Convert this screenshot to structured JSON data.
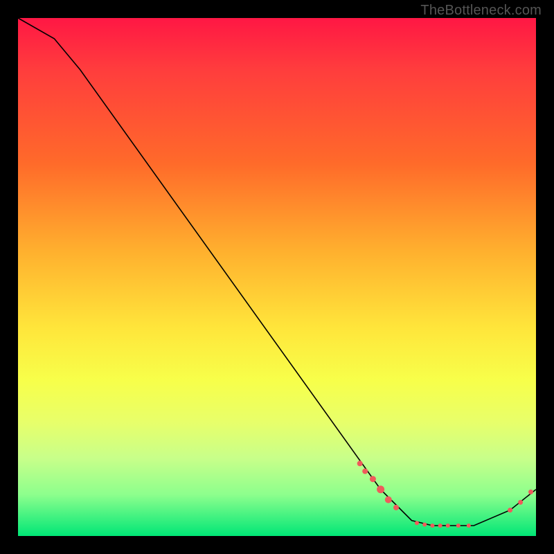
{
  "watermark": "TheBottleneck.com",
  "colors": {
    "gradient_top": "#ff1744",
    "gradient_mid": "#ffe63b",
    "gradient_bottom": "#00e676",
    "curve": "#000000",
    "marker": "#ef5b5b",
    "background": "#000000"
  },
  "chart_data": {
    "type": "line",
    "title": "",
    "xlabel": "",
    "ylabel": "",
    "xlim": [
      0,
      100
    ],
    "ylim": [
      0,
      100
    ],
    "curve": [
      {
        "x": 0,
        "y": 100
      },
      {
        "x": 7,
        "y": 96
      },
      {
        "x": 12,
        "y": 90
      },
      {
        "x": 70,
        "y": 9
      },
      {
        "x": 76,
        "y": 3
      },
      {
        "x": 80,
        "y": 2
      },
      {
        "x": 88,
        "y": 2
      },
      {
        "x": 95,
        "y": 5
      },
      {
        "x": 100,
        "y": 9
      }
    ],
    "marker_clusters": [
      {
        "x": 66,
        "y": 14,
        "r": 4
      },
      {
        "x": 67,
        "y": 12.5,
        "r": 4
      },
      {
        "x": 68.5,
        "y": 11,
        "r": 4.5
      },
      {
        "x": 70,
        "y": 9,
        "r": 5.5
      },
      {
        "x": 71.5,
        "y": 7,
        "r": 5
      },
      {
        "x": 73,
        "y": 5.5,
        "r": 4
      },
      {
        "x": 77,
        "y": 2.5,
        "r": 3
      },
      {
        "x": 78.5,
        "y": 2.2,
        "r": 3
      },
      {
        "x": 80,
        "y": 2,
        "r": 3
      },
      {
        "x": 81.5,
        "y": 2,
        "r": 3
      },
      {
        "x": 83,
        "y": 2,
        "r": 3
      },
      {
        "x": 85,
        "y": 2,
        "r": 3
      },
      {
        "x": 87,
        "y": 2,
        "r": 3
      },
      {
        "x": 95,
        "y": 5,
        "r": 3.5
      },
      {
        "x": 97,
        "y": 6.5,
        "r": 3.5
      },
      {
        "x": 99,
        "y": 8.5,
        "r": 3.5
      }
    ]
  }
}
